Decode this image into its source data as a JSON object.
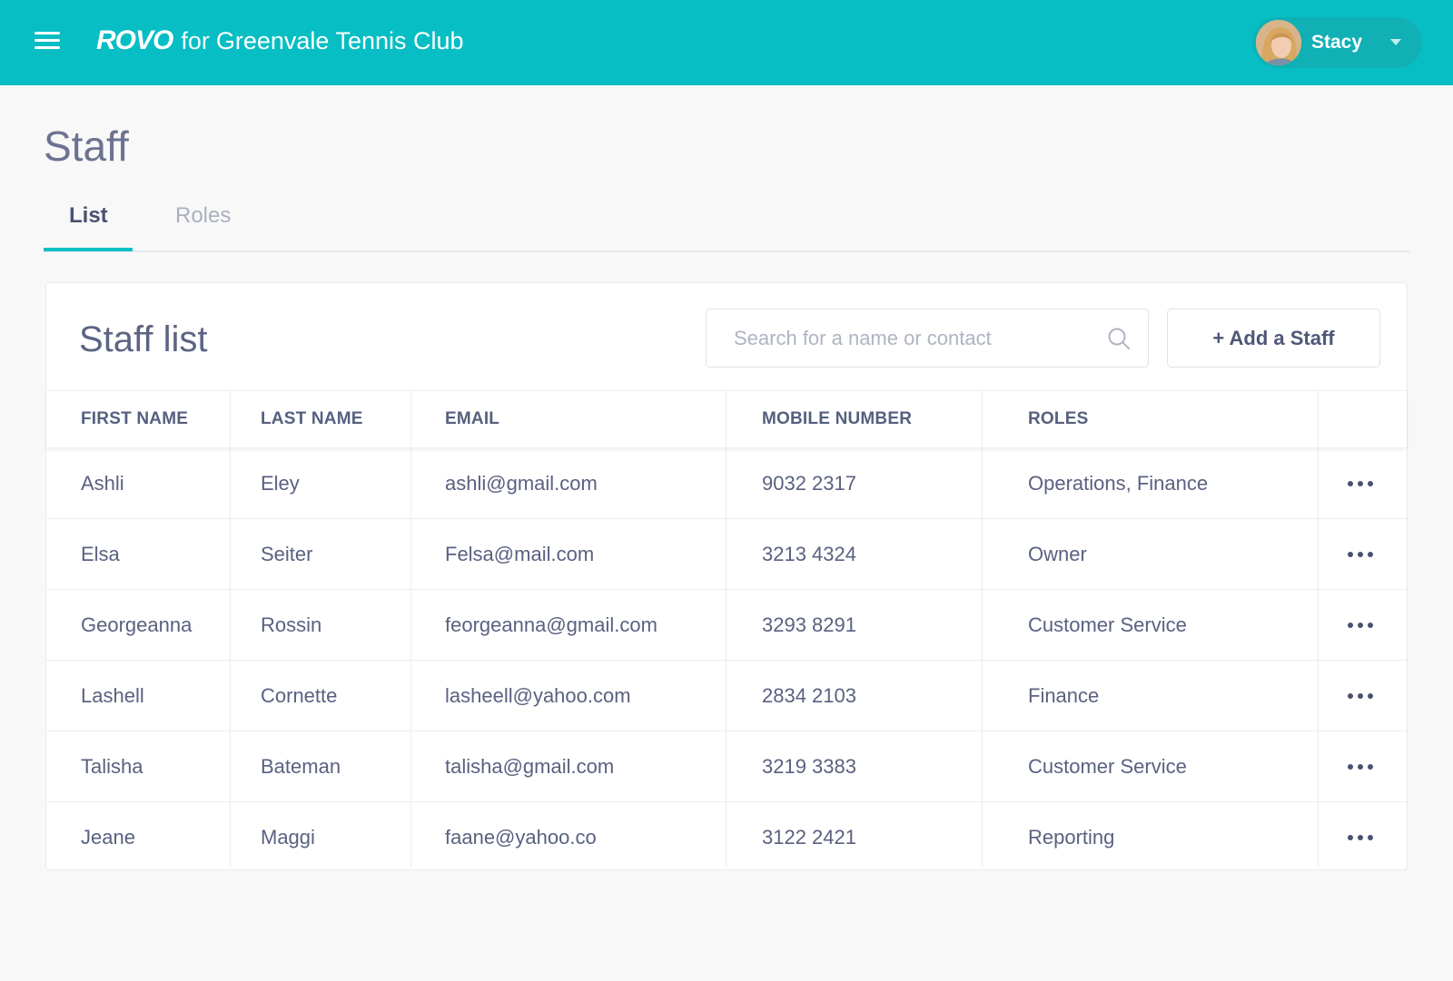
{
  "header": {
    "brand_logo": "ROVO",
    "brand_for": "for",
    "club_name": "Greenvale Tennis Club",
    "user_name": "Stacy",
    "colors": {
      "accent": "#06bec3"
    }
  },
  "page": {
    "title": "Staff",
    "tabs": [
      {
        "label": "List",
        "active": true
      },
      {
        "label": "Roles",
        "active": false
      }
    ]
  },
  "card": {
    "title": "Staff list",
    "search_placeholder": "Search for a name or contact",
    "add_button": "+ Add a Staff"
  },
  "table": {
    "columns": [
      "FIRST NAME",
      "LAST NAME",
      "EMAIL",
      "MOBILE NUMBER",
      "ROLES"
    ],
    "rows": [
      {
        "first": "Ashli",
        "last": "Eley",
        "email": "ashli@gmail.com",
        "mobile": "9032 2317",
        "roles": "Operations, Finance"
      },
      {
        "first": "Elsa",
        "last": "Seiter",
        "email": "Felsa@mail.com",
        "mobile": "3213 4324",
        "roles": "Owner"
      },
      {
        "first": "Georgeanna",
        "last": "Rossin",
        "email": "feorgeanna@gmail.com",
        "mobile": "3293 8291",
        "roles": "Customer Service"
      },
      {
        "first": "Lashell",
        "last": "Cornette",
        "email": "lasheell@yahoo.com",
        "mobile": "2834 2103",
        "roles": "Finance"
      },
      {
        "first": "Talisha",
        "last": "Bateman",
        "email": "talisha@gmail.com",
        "mobile": "3219 3383",
        "roles": "Customer Service"
      },
      {
        "first": "Jeane",
        "last": "Maggi",
        "email": "faane@yahoo.co",
        "mobile": "3122 2421",
        "roles": "Reporting"
      }
    ]
  },
  "icons": {
    "menu": "hamburger-menu-icon",
    "search": "search-icon",
    "more": "more-horizontal-icon",
    "dropdown": "chevron-down-icon"
  }
}
